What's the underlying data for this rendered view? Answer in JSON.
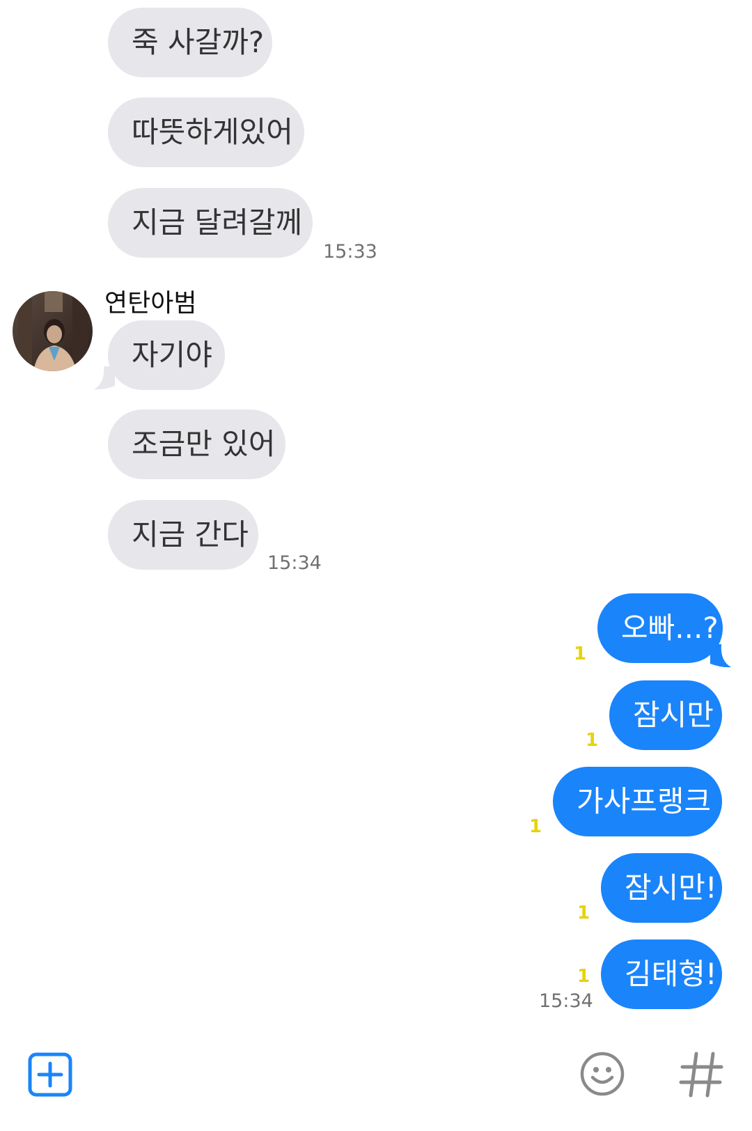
{
  "incoming_group_1": {
    "messages": [
      "죽 사갈까?",
      "따뜻하게있어",
      "지금 달려갈께"
    ],
    "time": "15:33"
  },
  "incoming_group_2": {
    "sender": "연탄아범",
    "messages": [
      "자기야",
      "조금만 있어",
      "지금 간다"
    ],
    "time": "15:34"
  },
  "outgoing_group": {
    "messages": [
      "오빠...?",
      "잠시만",
      "가사프랭크",
      "잠시만!",
      "김태형!"
    ],
    "unread": [
      "1",
      "1",
      "1",
      "1",
      "1"
    ],
    "time": "15:34"
  },
  "colors": {
    "incoming_bubble": "#e6e6eb",
    "outgoing_bubble": "#1a84fb",
    "unread_count": "#e8d20a",
    "toolbar_icon": "#1a84fb",
    "toolbar_icon_muted": "#8a8a8a"
  },
  "toolbar": {
    "icons": [
      "plus-square-icon",
      "emoji-icon",
      "hashtag-icon"
    ]
  }
}
